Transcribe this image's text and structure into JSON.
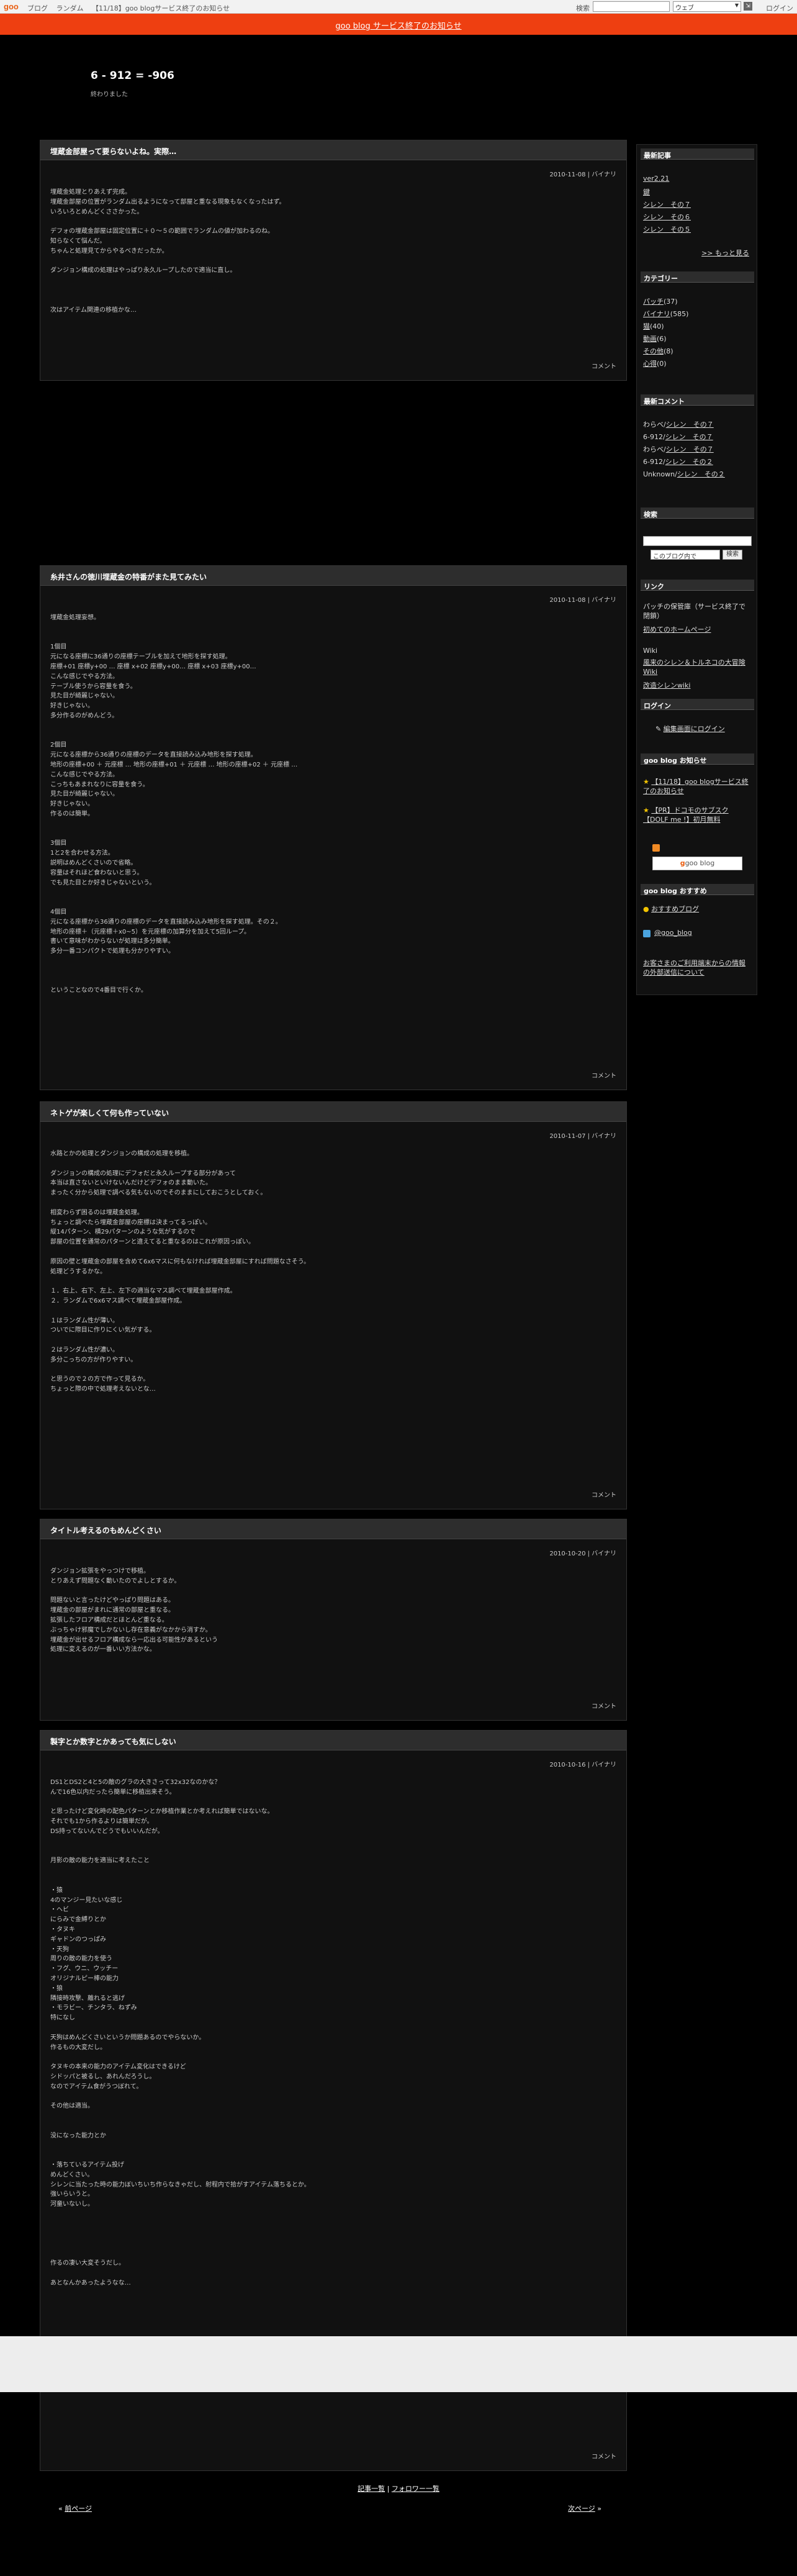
{
  "topbar": {
    "logo": "goo",
    "nav": [
      "ブログ",
      "ランダム",
      "【11/18】goo blogサービス終了のお知らせ"
    ],
    "search_label": "検索",
    "scope": "ウェブ",
    "login": "ログイン"
  },
  "notice": "goo blog サービス終了のお知らせ",
  "site": {
    "title": "6 - 912 = -906",
    "subtitle": "終わりました"
  },
  "posts": [
    {
      "title": "埋蔵金部屋って要らないよね。実際…",
      "meta": "2010-11-08 | バイナリ",
      "body": "埋蔵金処理とりあえず完成。\n埋蔵金部屋の位置がランダム出るようになって部屋と重なる現象もなくなったはず。\nいろいろとめんどくささかった。\n\nデフォの埋蔵金部屋は固定位置に＋０～５の範囲でランダムの値が加わるのね。\n知らなくて悩んだ。\nちゃんと処理見てからやるべきだったか。\n\nダンジョン構成の処理はやっぱり永久ループしたので適当に直し。\n\n\n\n次はアイテム関連の移植かな…",
      "comment": "コメント"
    },
    {
      "title": "糸井さんの徳川埋蔵金の特番がまた見てみたい",
      "meta": "2010-11-08 | バイナリ",
      "body": "埋蔵金処理妄想。\n\n\n1個目\n元になる座標に36通りの座標テーブルを加えて地形を探す処理。\n座標+01 座標y+00 … 座標 x+02 座標y+00… 座標 x+03 座標y+00…\nこんな感じでやる方法。\nテーブル使うから容量を食う。\n見た目が綺麗じゃない。\n好きじゃない。\n多分作るのがめんどう。\n\n\n2個目\n元になる座標から36通りの座標のデータを直接読み込み地形を探す処理。\n地形の座標+00 ＋ 元座標 … 地形の座標+01 ＋ 元座標 … 地形の座標+02 ＋ 元座標 …\nこんな感じでやる方法。\nこっちもあまれなりに容量を食う。\n見た目が綺麗じゃない。\n好きじゃない。\n作るのは簡単。\n\n\n3個目\n1と2を合わせる方法。\n説明はめんどくさいので省略。\n容量はそれほど食わないと思う。\nでも見た目とか好きじゃないという。\n\n\n4個目\n元になる座標から36通りの座標のデータを直接読み込み地形を探す処理。その２。\n地形の座標＋（元座標＋x0~5）を元座標の加算分を加えて5回ループ。\n書いて意味がわからないが処理は多分簡単。\n多分一番コンパクトで処理も分かりやすい。\n\n\n\nということなので4番目で行くか。",
      "comment": "コメント"
    },
    {
      "title": "ネトゲが楽しくて何も作っていない",
      "meta": "2010-11-07 | バイナリ",
      "body": "水路とかの処理とダンジョンの構成の処理を移植。\n\nダンジョンの構成の処理にデフォだと永久ループする部分があって\n本当は直さないといけないんだけどデフォのまま動いた。\nまったく分から処理で調べる気もないのでそのままにしておこうとしておく。\n\n相変わらず困るのは埋蔵金処理。\nちょっと調べたら埋蔵金部屋の座標は決まってるっぽい。\n縦14パターン、横29パターンのような気がするので\n部屋の位置を通常のパターンと違えてると重なるのはこれが原因っぽい。\n\n原因の壁と埋蔵金の部屋を含めて6x6マスに何もなければ埋蔵金部屋にすれば問題なさそう。\n処理どうするかな。\n\n１．右上、右下、左上、左下の適当なマス調べて埋蔵金部屋作成。\n２．ランダムで6x6マス調べて埋蔵金部屋作成。\n\n１はランダム性が薄い。\nついでに際目に作りにくい気がする。\n\n２はランダム性が濃い。\n多分こっちの方が作りやすい。\n\nと思うので２の方で作って見るか。\nちょっと際の中で処理考えないとな…",
      "comment": "コメント"
    },
    {
      "title": "タイトル考えるのもめんどくさい",
      "meta": "2010-10-20 | バイナリ",
      "body": "ダンジョン拡張をやっつけで移植。\nとりあえず問題なく動いたのでよしとするか。\n\n問題ないと言ったけどやっぱり問題はある。\n埋蔵金の部屋がまれに通常の部屋と重なる。\n拡張したフロア構成だとほとんど重なる。\nぶっちゃけ邪魔でしかないし存在意義がなかから消すか。\n埋蔵金が出せるフロア構成なら一応出る可能性があるという\n処理に変えるのが一番いい方法かな。",
      "comment": "コメント"
    },
    {
      "title": "製字とか数字とかあっても気にしない",
      "meta": "2010-10-16 | バイナリ",
      "body": "DS1とDS2と4と5の敵のグラの大きさって32x32なのかな？\nんで16色以内だったら簡単に移植出来そう。\n\nと思ったけど変化時の配色パターンとか移植作業とか考えれば簡単ではないな。\nそれでも1から作るよりは簡単だが。\nDS持ってないんでどうでもいいんだが。\n\n\n月影の敵の能力を適当に考えたこと\n\n\n・猿\n4のマンジー見たいな感じ\n・ヘビ\nにらみで金縛りとか\n・タヌキ\nギャドンのつっぱみ\n・天狗\n周りの敵の能力を使う\n・フグ、ウニ、ウッチー\nオリジナルピー棒の能力\n・狼\n隣接時攻撃、離れると逃げ\n・モラビー、チンタラ、ねずみ\n特になし\n\n天狗はめんどくさいというか問題あるのでやらないか。\n作るもの大変だし。\n\nタヌキの本来の能力のアイテム変化はできるけど\nシドッパと被るし、あれんだろうし。\nなのでアイテム食がうつぼれて。\n\nその他は適当。\n\n\n没になった能力とか\n\n\n・落ちているアイテム投げ\nめんどくさい。\nシレンに当たった時の能力ぼいちいち作らなきゃだし、射程内で拾がすアイテム落ちるとか。\n強いらいうと。\n河童いないし。\n\n\n\n\n\n作るの凄い大変そうだし。\n\nあとなんかあったようなな…",
      "comment": "コメント"
    }
  ],
  "sidebar": {
    "recent_posts_title": "最新記事",
    "recent_posts": [
      "ver2.21",
      "鍵",
      "シレン　その７",
      "シレン　その６",
      "シレン　その５"
    ],
    "more": ">> もっと見る",
    "categories_title": "カテゴリー",
    "categories": [
      {
        "name": "パッチ",
        "count": "(37)"
      },
      {
        "name": "バイナリ",
        "count": "(585)"
      },
      {
        "name": "猫",
        "count": "(40)"
      },
      {
        "name": "動画",
        "count": "(6)"
      },
      {
        "name": "その他",
        "count": "(8)"
      },
      {
        "name": "心得",
        "count": "(0)"
      }
    ],
    "comments_title": "最新コメント",
    "comments": [
      {
        "user": "わらベ/",
        "post": "シレン　その７"
      },
      {
        "user": "6-912/",
        "post": "シレン　その７"
      },
      {
        "user": "わらベ/",
        "post": "シレン　その７"
      },
      {
        "user": "6-912/",
        "post": "シレン　その２"
      },
      {
        "user": "Unknown/",
        "post": "シレン　その２"
      }
    ],
    "search_title": "検索",
    "search_scope": "このブログ内で",
    "search_button": "検索",
    "links_title": "リンク",
    "links_intro": "パッチの保管庫（サービス終了で閉鎖）",
    "links_item1": "初めてのホームページ",
    "links_wiki_label": "Wiki",
    "links_wiki1": "風来のシレン＆トルネコの大冒険 Wiki",
    "links_wiki2": "改造シレンwiki",
    "login_title": "ログイン",
    "login_link": "編集画面にログイン",
    "news_title": "goo blog お知らせ",
    "news": [
      "【11/18】goo blogサービス終了のお知らせ",
      "【PR】ドコモのサブスク【DOLF me !】初月無料"
    ],
    "goo_button": "goo blog",
    "recommend_title": "goo blog おすすめ",
    "recommend": "おすすめブログ",
    "twitter": "@goo_blog",
    "info_link": "お客さまのご利用端末からの情報の外部送信について"
  },
  "footer": {
    "list": "記事一覧",
    "sep": " | ",
    "follow": "フォロワー一覧",
    "prev": "前ページ",
    "next": "次ページ"
  }
}
